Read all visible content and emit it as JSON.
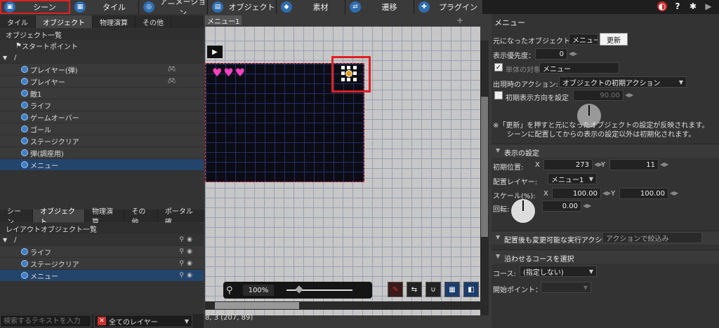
{
  "top_tabs": [
    {
      "label": "シーン",
      "icon": "scene-icon",
      "active": true
    },
    {
      "label": "タイル",
      "icon": "tile-icon"
    },
    {
      "label": "アニメーション",
      "icon": "animation-icon"
    },
    {
      "label": "オブジェクト",
      "icon": "object-icon"
    },
    {
      "label": "素材",
      "icon": "material-icon"
    },
    {
      "label": "遷移",
      "icon": "transition-icon"
    },
    {
      "label": "プラグイン",
      "icon": "plugin-icon"
    }
  ],
  "top_icons": [
    "ruby-icon",
    "help-icon",
    "gear-icon",
    "play-icon"
  ],
  "upper_panel": {
    "tabs": [
      "タイル",
      "オブジェクト",
      "物理演算",
      "その他"
    ],
    "active_tab": 1,
    "label": "オブジェクト一覧",
    "start_point": "スタートポイント",
    "root": "/",
    "items": [
      {
        "name": "プレイヤー(弾)",
        "controller": true
      },
      {
        "name": "プレイヤー",
        "controller": true
      },
      {
        "name": "敵1"
      },
      {
        "name": "ライフ"
      },
      {
        "name": "ゲームオーバー"
      },
      {
        "name": "ゴール"
      },
      {
        "name": "ステージクリア"
      },
      {
        "name": "弾(調座用)"
      },
      {
        "name": "メニュー",
        "selected": true
      }
    ]
  },
  "lower_panel": {
    "tabs": [
      "シーン",
      "オブジェクト",
      "物理演算",
      "その他",
      "ポータル確"
    ],
    "active_tab": 1,
    "label": "レイアウトオブジェクト一覧",
    "root": "/",
    "items": [
      {
        "name": "ライフ"
      },
      {
        "name": "ステージクリア"
      },
      {
        "name": "メニュー",
        "selected": true
      }
    ]
  },
  "search": {
    "placeholder": "検索するテキストを入力"
  },
  "layer_filter": {
    "value": "全てのレイヤー"
  },
  "canvas": {
    "tab": "メニュー1",
    "hearts": 3,
    "zoom": "100%",
    "zoom_level": 0.15,
    "coord_readout": "8, 3 (207, 89)",
    "tools": [
      "brush-icon",
      "link-icon",
      "magnet-icon",
      "grid-icon",
      "layer-icon"
    ]
  },
  "props": {
    "title": "メニュー",
    "source_label": "元になったオブジェクト:",
    "source_value": "メニュー",
    "update_btn": "更新",
    "priority_label": "表示優先度：",
    "priority_value": "0",
    "single_target_label": "単体の対象",
    "single_target_value": "メニュー",
    "appear_action_label": "出現時のアクション:",
    "appear_action_value": "オブジェクトの初期アクション",
    "init_dir_label": "初期表示方向を設定",
    "init_dir_value": "90.00",
    "note1": "※「更新」を押すと元になったオブジェクトの設定が反映されます。",
    "note2": "シーンに配置してからの表示の設定以外は初期化されます。",
    "display_section": "表示の設定",
    "init_pos_label": "初期位置:",
    "x_label": "X",
    "pos_x": "273",
    "y_label": "Y",
    "pos_y": "11",
    "layer_label": "配置レイヤー:",
    "layer_value": "メニュー1",
    "scale_label": "スケール(%):",
    "scale_x": "100.00",
    "scale_y": "100.00",
    "rotation_label": "回転:",
    "rotation_value": "0.00",
    "action_section": "配置後も変更可能な実行アクシ",
    "action_filter": "アクションで絞込み",
    "course_section": "沿わせるコースを選択",
    "course_label": "コース:",
    "course_value": "(指定しない)",
    "start_point_label": "開始ポイント："
  }
}
